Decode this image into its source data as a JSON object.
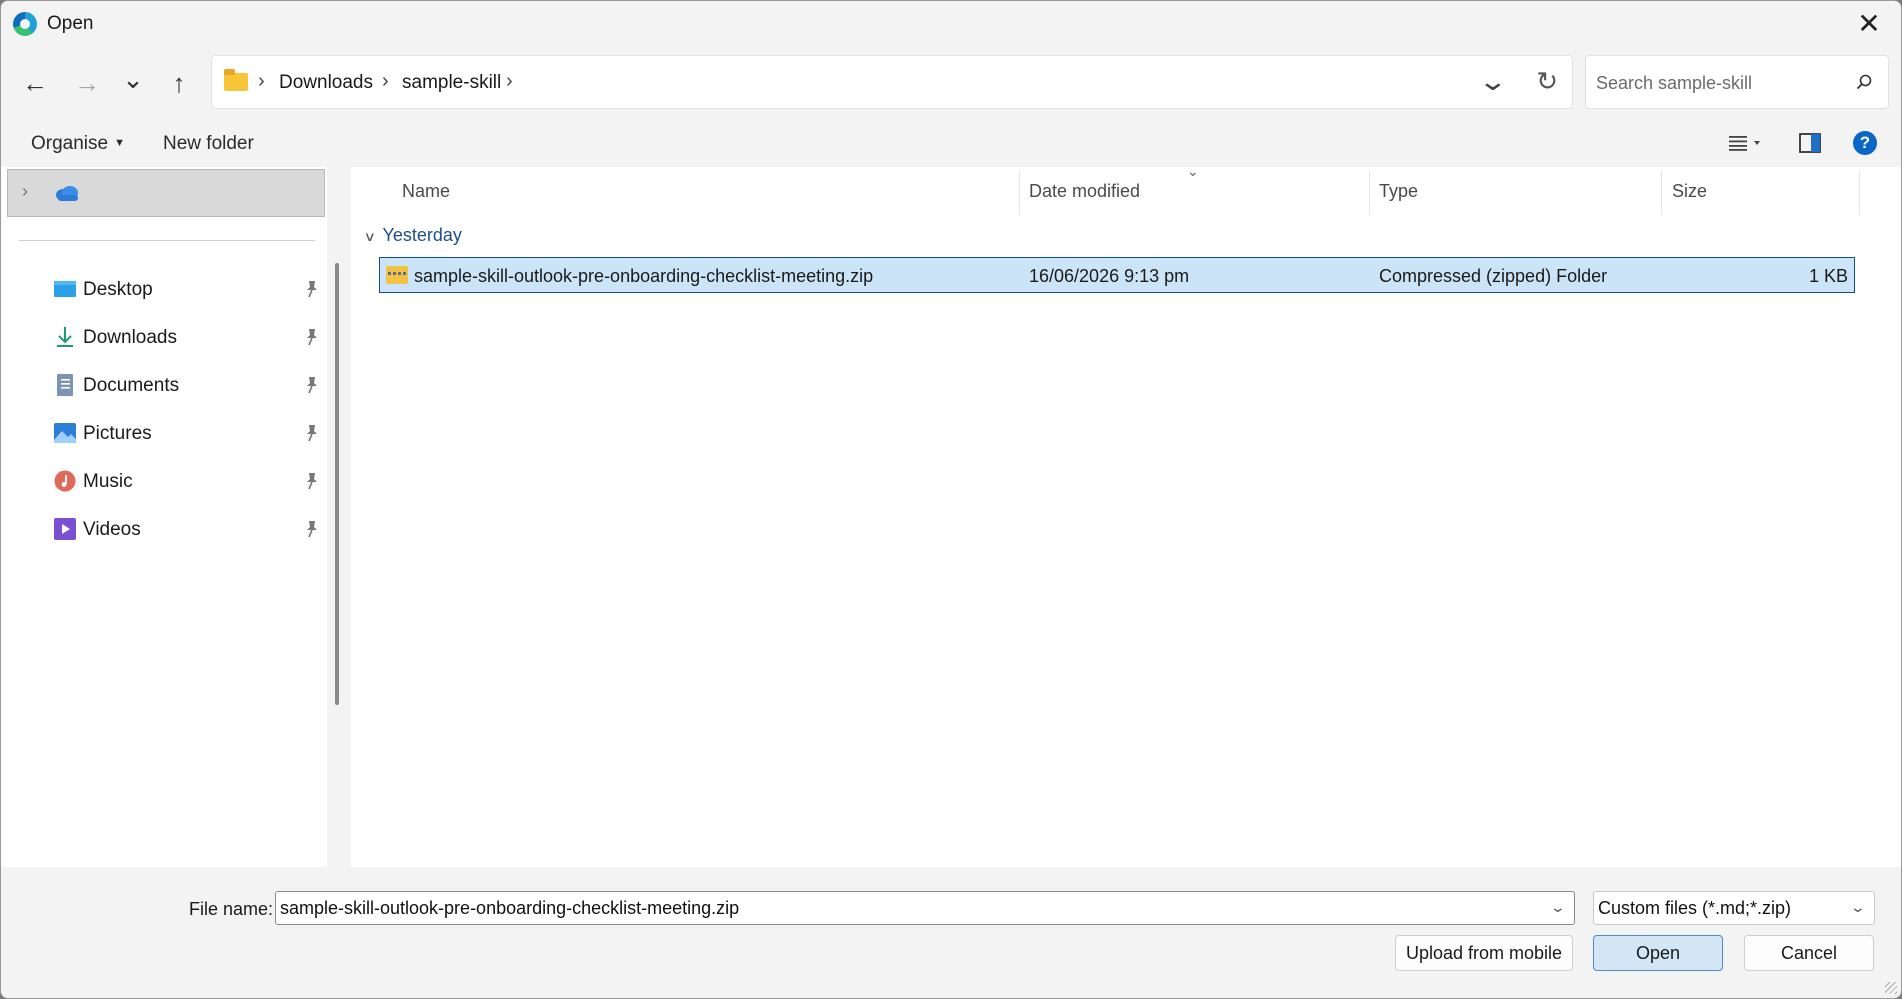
{
  "window": {
    "title": "Open",
    "close_symbol": "✕"
  },
  "nav_buttons": {
    "back_symbol": "←",
    "forward_symbol": "→",
    "recent_symbol": "⌄",
    "up_symbol": "↑"
  },
  "breadcrumb": {
    "separator": "›",
    "items": [
      "Downloads",
      "sample-skill"
    ]
  },
  "search": {
    "placeholder": "Search sample-skill"
  },
  "toolbar": {
    "organise_label": "Organise",
    "new_folder_label": "New folder",
    "help_label": "?"
  },
  "sidebar": {
    "items": [
      {
        "label": "Desktop",
        "icon": "desktop-icon"
      },
      {
        "label": "Downloads",
        "icon": "download-icon"
      },
      {
        "label": "Documents",
        "icon": "documents-icon"
      },
      {
        "label": "Pictures",
        "icon": "pictures-icon"
      },
      {
        "label": "Music",
        "icon": "music-icon"
      },
      {
        "label": "Videos",
        "icon": "videos-icon"
      }
    ]
  },
  "file_list": {
    "columns": [
      "Name",
      "Date modified",
      "Type",
      "Size"
    ],
    "group_label": "Yesterday",
    "rows": [
      {
        "name": "sample-skill-outlook-pre-onboarding-checklist-meeting.zip",
        "date_modified": "16/06/2026 9:13 pm",
        "type": "Compressed (zipped) Folder",
        "size": "1 KB"
      }
    ]
  },
  "footer": {
    "file_name_label": "File name:",
    "file_name_value": "sample-skill-outlook-pre-onboarding-checklist-meeting.zip",
    "filter_value": "Custom files (*.md;*.zip)",
    "upload_label": "Upload from mobile",
    "open_label": "Open",
    "cancel_label": "Cancel"
  },
  "colors": {
    "selection": "#cce4f7",
    "selection_border": "#0e4f8c",
    "accent": "#0a67c8"
  }
}
